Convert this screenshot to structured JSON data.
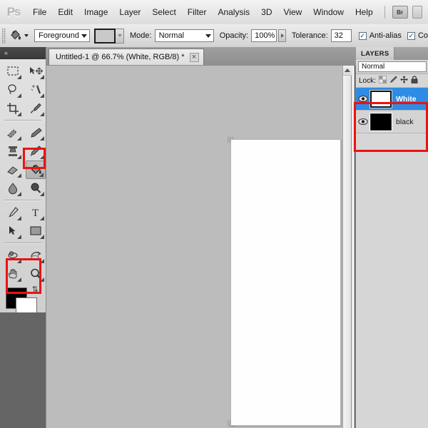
{
  "app": {
    "name": "Adobe Photoshop",
    "logo_text": "Ps"
  },
  "menubar": {
    "items": [
      {
        "label": "File"
      },
      {
        "label": "Edit"
      },
      {
        "label": "Image"
      },
      {
        "label": "Layer"
      },
      {
        "label": "Select"
      },
      {
        "label": "Filter"
      },
      {
        "label": "Analysis"
      },
      {
        "label": "3D"
      },
      {
        "label": "View"
      },
      {
        "label": "Window"
      },
      {
        "label": "Help"
      }
    ],
    "bridge_button": "Br"
  },
  "options_bar": {
    "tool_icon": "paint-bucket-icon",
    "fill_source": "Foreground",
    "mode_label": "Mode:",
    "mode_value": "Normal",
    "opacity_label": "Opacity:",
    "opacity_value": "100%",
    "tolerance_label": "Tolerance:",
    "tolerance_value": "32",
    "antialias_label": "Anti-alias",
    "antialias_checked": "✓",
    "contiguous_label": "Co",
    "contiguous_checked": "✓"
  },
  "document_tab": {
    "title": "Untitled-1 @ 66.7% (White, RGB/8) *",
    "close_glyph": "×"
  },
  "toolbox": {
    "collapse_glyph": "«",
    "tools": [
      {
        "name": "rectangular-marquee-tool",
        "row": 0,
        "col": 0
      },
      {
        "name": "move-tool",
        "row": 0,
        "col": 1
      },
      {
        "name": "lasso-tool",
        "row": 1,
        "col": 0
      },
      {
        "name": "magic-wand-tool",
        "row": 1,
        "col": 1
      },
      {
        "name": "crop-tool",
        "row": 2,
        "col": 0
      },
      {
        "name": "eyedropper-tool",
        "row": 2,
        "col": 1
      },
      {
        "name": "healing-brush-tool",
        "row": 3,
        "col": 0
      },
      {
        "name": "brush-tool",
        "row": 3,
        "col": 1
      },
      {
        "name": "clone-stamp-tool",
        "row": 4,
        "col": 0
      },
      {
        "name": "history-brush-tool",
        "row": 4,
        "col": 1
      },
      {
        "name": "eraser-tool",
        "row": 5,
        "col": 0
      },
      {
        "name": "paint-bucket-tool",
        "row": 5,
        "col": 1,
        "selected": true
      },
      {
        "name": "blur-tool",
        "row": 6,
        "col": 0
      },
      {
        "name": "dodge-tool",
        "row": 6,
        "col": 1
      },
      {
        "name": "pen-tool",
        "row": 7,
        "col": 0
      },
      {
        "name": "type-tool",
        "row": 7,
        "col": 1
      },
      {
        "name": "path-selection-tool",
        "row": 8,
        "col": 0
      },
      {
        "name": "rectangle-shape-tool",
        "row": 8,
        "col": 1
      },
      {
        "name": "rotate-3d-tool",
        "row": 9,
        "col": 0
      },
      {
        "name": "orbit-3d-tool",
        "row": 9,
        "col": 1
      },
      {
        "name": "hand-tool",
        "row": 10,
        "col": 0
      },
      {
        "name": "zoom-tool",
        "row": 10,
        "col": 1
      }
    ],
    "foreground_color": "#000000",
    "background_color": "#ffffff",
    "quickmask_label": "quick-mask-mode"
  },
  "layers_panel": {
    "tab_label": "LAYERS",
    "blend_mode": "Normal",
    "lock_label": "Lock:",
    "lock_icons": [
      "lock-transparent-pixels-icon",
      "lock-image-pixels-icon",
      "lock-position-icon",
      "lock-all-icon"
    ],
    "layers": [
      {
        "name": "White",
        "thumbnail_color": "#ffffff",
        "visible": true,
        "selected": true
      },
      {
        "name": "black",
        "thumbnail_color": "#000000",
        "visible": true,
        "selected": false
      }
    ]
  },
  "canvas": {
    "document_background": "#fefefe",
    "workspace_background": "#bcbcbc"
  },
  "annotations": {
    "highlight_color": "#ee1111",
    "regions": [
      {
        "name": "layers-highlight",
        "target": "layers list"
      },
      {
        "name": "paint-bucket-highlight",
        "target": "paint bucket tool"
      },
      {
        "name": "color-swatch-highlight",
        "target": "foreground/background color"
      }
    ]
  }
}
